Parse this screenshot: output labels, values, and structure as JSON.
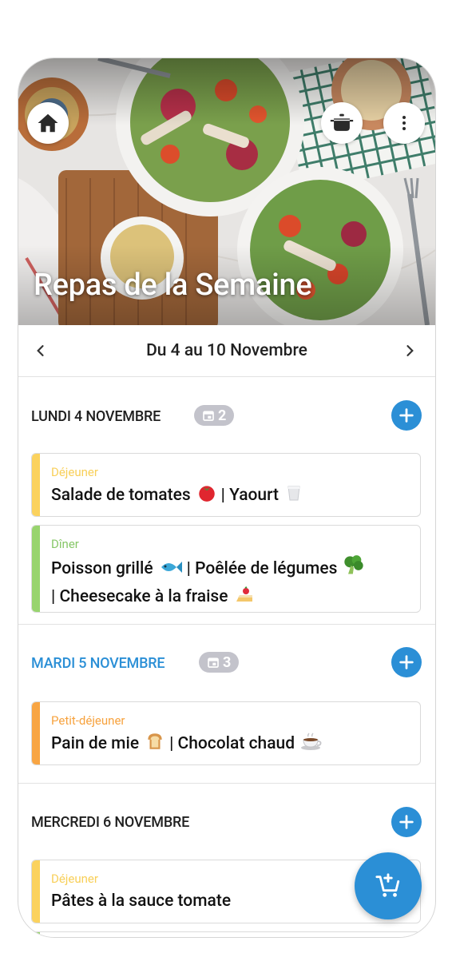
{
  "hero": {
    "title": "Repas de la Semaine"
  },
  "week": {
    "range": "Du 4 au 10 Novembre"
  },
  "days": [
    {
      "title": "LUNDI 4 NOVEMBRE",
      "count": "2",
      "meals": [
        {
          "label": "Déjeuner",
          "label_color": "#f8cf58",
          "bar_color": "#fbd25e",
          "items": [
            "Salade de tomates",
            "| Yaourt"
          ]
        },
        {
          "label": "Dîner",
          "label_color": "#86c767",
          "bar_color": "#98d46e",
          "items": [
            "Poisson grillé",
            "| Poêlée de légumes",
            "| Cheesecake à la fraise"
          ]
        }
      ]
    },
    {
      "title": "MARDI 5 NOVEMBRE",
      "count": "3",
      "meals": [
        {
          "label": "Petit-déjeuner",
          "label_color": "#f7a23d",
          "bar_color": "#f8a543",
          "items": [
            "Pain de mie",
            "| Chocolat chaud"
          ]
        }
      ]
    },
    {
      "title": "MERCREDI 6 NOVEMBRE",
      "meals": [
        {
          "label": "Déjeuner",
          "label_color": "#f8cf58",
          "bar_color": "#fbd25e",
          "items": [
            "Pâtes à la sauce tomate"
          ]
        }
      ]
    }
  ],
  "colors": {
    "accent": "#2b8fd6",
    "badge": "#c3c3cb"
  },
  "icons": {
    "home": "home-icon",
    "pot": "cooking-pot-icon",
    "more": "more-vertical-icon",
    "prev": "chevron-left-icon",
    "next": "chevron-right-icon",
    "add": "plus-icon",
    "calendar": "calendar-icon",
    "cart": "cart-add-icon"
  }
}
